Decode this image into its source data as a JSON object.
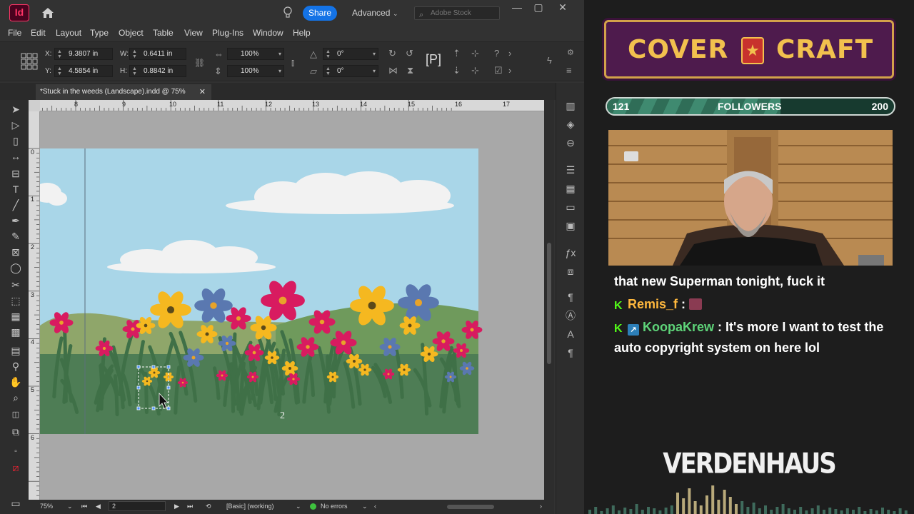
{
  "app": {
    "logo": "Id",
    "share_label": "Share",
    "workspace": "Advanced",
    "search_placeholder": "Adobe Stock",
    "window_controls": [
      "—",
      "▢",
      "✕"
    ]
  },
  "menu": [
    "File",
    "Edit",
    "Layout",
    "Type",
    "Object",
    "Table",
    "View",
    "Plug-Ins",
    "Window",
    "Help"
  ],
  "control": {
    "x_label": "X:",
    "x_value": "9.3807 in",
    "y_label": "Y:",
    "y_value": "4.5854 in",
    "w_label": "W:",
    "w_value": "0.6411 in",
    "h_label": "H:",
    "h_value": "0.8842 in",
    "scale_x": "100%",
    "scale_y": "100%",
    "rotate": "0°",
    "shear": "0°"
  },
  "document": {
    "tab_title": "*Stuck in the weeds (Landscape).indd @ 75%",
    "page_number": "2"
  },
  "ruler": {
    "h_ticks": [
      "8",
      "9",
      "10",
      "11",
      "12",
      "13",
      "14",
      "15",
      "16",
      "17"
    ],
    "v_ticks": [
      "0",
      "1",
      "2",
      "3",
      "4",
      "5",
      "6"
    ]
  },
  "status": {
    "zoom": "75%",
    "page": "2",
    "master": "[Basic] (working)",
    "preflight": "No errors"
  },
  "overlay": {
    "banner_left": "COVER",
    "banner_right": "CRAFT",
    "followers_current": "121",
    "followers_label": "FOLLOWERS",
    "followers_goal": "200",
    "followers_progress": 0.605,
    "chat": [
      {
        "text": "that new Superman tonight, fuck it"
      },
      {
        "user": "Remis_f",
        "sep": " :"
      },
      {
        "user": "KoopaKrew",
        "text": " : It's more I want to test the auto copyright system on here lol"
      }
    ],
    "brand": "VERDENHAUS"
  },
  "colors": {
    "accent_blue": "#1473e6",
    "sky": "#a9d6e8",
    "grass": "#4e7d55",
    "banner_bg": "#4e1b4d",
    "banner_gold": "#f2c14e"
  }
}
